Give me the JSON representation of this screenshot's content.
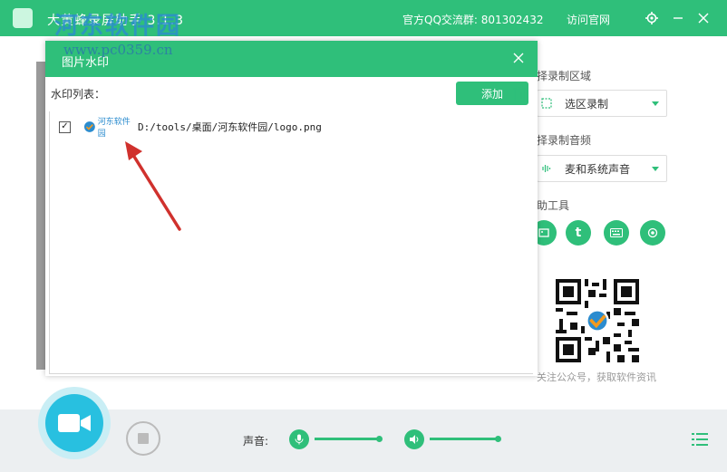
{
  "titlebar": {
    "app_title": "大黄蜂录屏助手 3.1.3",
    "watermark_site": "河东软件园",
    "watermark_url": "www.pc0359.cn",
    "qq_group": "官方QQ交流群: 801302432",
    "visit_site": "访问官网"
  },
  "right_panel": {
    "region_label": "择录制区域",
    "region_value": "选区录制",
    "audio_label": "择录制音频",
    "audio_value": "麦和系统声音",
    "tools_label": "助工具",
    "tools": [
      "image-icon",
      "t-icon",
      "keyboard-icon",
      "camera-icon"
    ],
    "footer": "关注公众号，获取软件资讯"
  },
  "dialog": {
    "title": "图片水印",
    "list_label": "水印列表：",
    "add_label": "添加",
    "items": [
      {
        "checked": true,
        "thumb_text": "河东软件园",
        "path": "D:/tools/桌面/河东软件园/logo.png"
      }
    ]
  },
  "bottom": {
    "sound_label": "声音:",
    "mic_level": 0.9,
    "speaker_level": 0.95
  },
  "colors": {
    "accent": "#2fbf7a",
    "record": "#28c0e0",
    "arrow": "#d0312d"
  }
}
